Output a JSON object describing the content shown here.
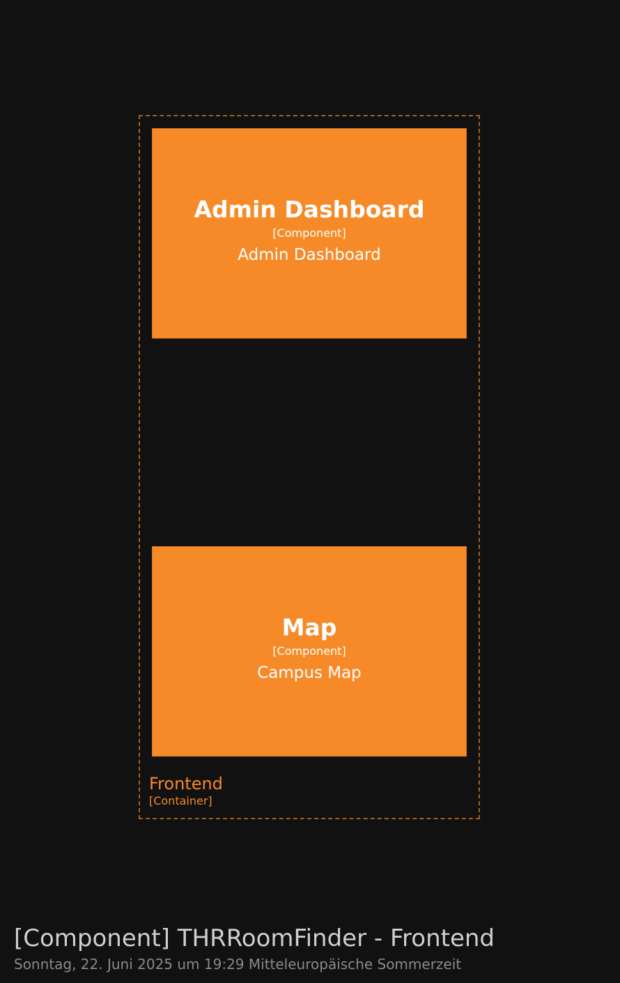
{
  "container": {
    "name": "Frontend",
    "type": "[Container]"
  },
  "components": [
    {
      "name": "Admin Dashboard",
      "type": "[Component]",
      "description": "Admin Dashboard"
    },
    {
      "name": "Map",
      "type": "[Component]",
      "description": "Campus Map"
    }
  ],
  "footer": {
    "title": "[Component] THRRoomFinder - Frontend",
    "date": "Sonntag, 22. Juni 2025 um 19:29 Mitteleuropäische Sommerzeit"
  },
  "colors": {
    "background": "#111111",
    "component_fill": "#f68a28",
    "boundary_stroke": "#a85f1c",
    "boundary_label": "#f68a28",
    "title_text": "#cfcfcf",
    "date_text": "#8a8a8a"
  }
}
